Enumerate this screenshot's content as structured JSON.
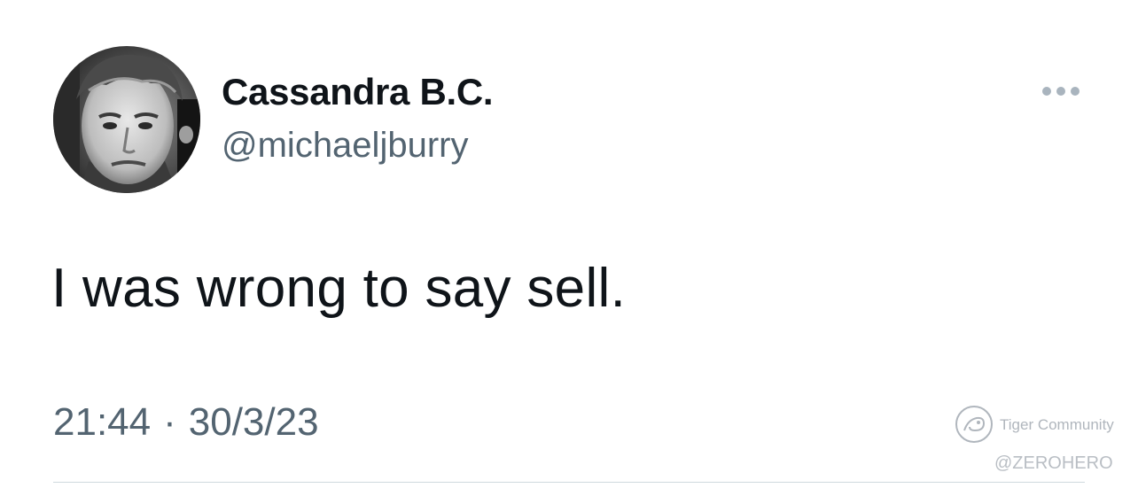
{
  "tweet": {
    "author_name": "Cassandra B.C.",
    "author_handle": "@michaeljburry",
    "text": "I was wrong to say sell.",
    "time": "21:44",
    "separator": "·",
    "date": "30/3/23"
  },
  "icons": {
    "more": "more-horizontal-icon",
    "avatar": "profile-photo"
  },
  "watermark": {
    "brand": "Tiger Community",
    "user": "@ZEROHERO"
  },
  "colors": {
    "text_primary": "#0f1419",
    "text_secondary": "#536471",
    "divider": "#cfd9de",
    "more_dots": "#a9b4be",
    "watermark": "#b0b6bd"
  }
}
